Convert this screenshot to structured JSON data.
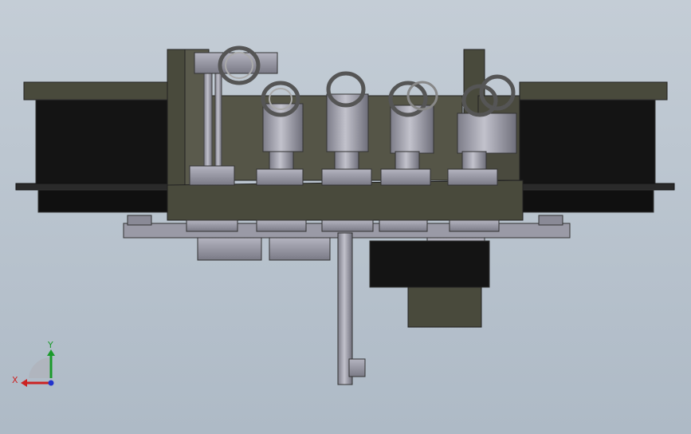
{
  "view": {
    "background_top": "#c4cdd6",
    "background_bottom": "#aebac6",
    "part_dark": "#494a3c",
    "part_black": "#141414",
    "part_grey": "#9a9aa6"
  },
  "triad": {
    "y_label": "Y",
    "x_label": "X",
    "y_color": "#1a9a2a",
    "x_color": "#cc2222",
    "z_color": "#2233cc"
  }
}
